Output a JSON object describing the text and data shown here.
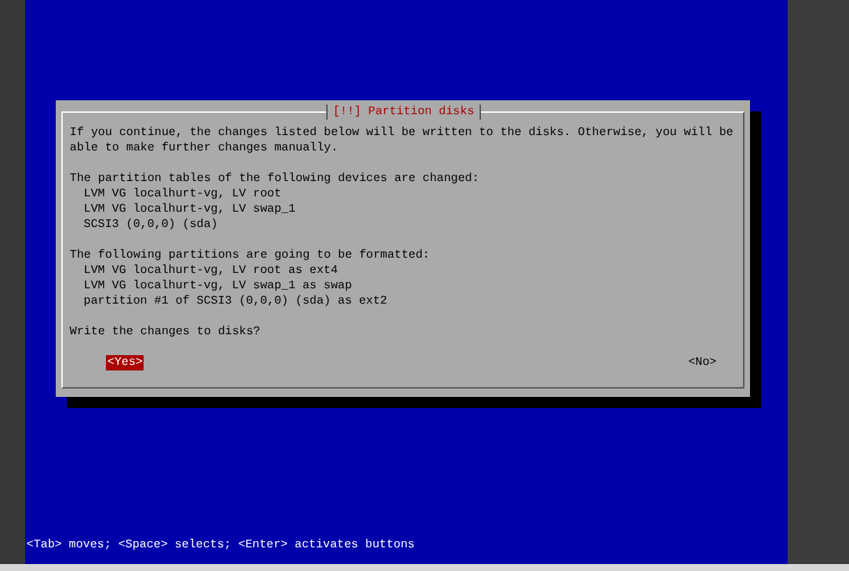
{
  "dialog": {
    "title": "[!!] Partition disks",
    "intro": "If you continue, the changes listed below will be written to the disks. Otherwise, you will be able to make further changes manually.",
    "sections": [
      {
        "heading": "The partition tables of the following devices are changed:",
        "items": [
          "LVM VG localhurt-vg, LV root",
          "LVM VG localhurt-vg, LV swap_1",
          "SCSI3 (0,0,0) (sda)"
        ]
      },
      {
        "heading": "The following partitions are going to be formatted:",
        "items": [
          "LVM VG localhurt-vg, LV root as ext4",
          "LVM VG localhurt-vg, LV swap_1 as swap",
          "partition #1 of SCSI3 (0,0,0) (sda) as ext2"
        ]
      }
    ],
    "question": "Write the changes to disks?",
    "buttons": [
      {
        "label": "<Yes>",
        "selected": true
      },
      {
        "label": "<No>",
        "selected": false
      }
    ]
  },
  "status_bar": "<Tab> moves; <Space> selects; <Enter> activates buttons"
}
